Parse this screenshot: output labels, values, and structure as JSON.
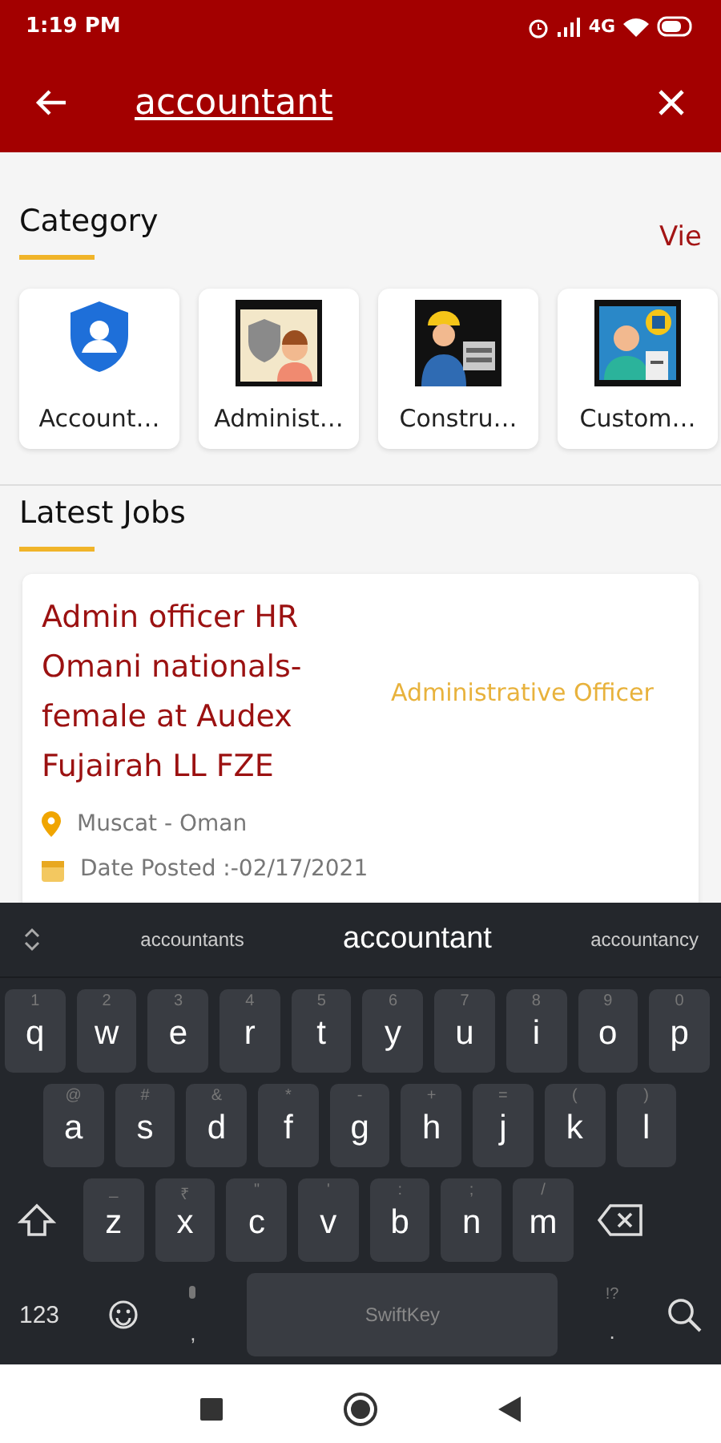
{
  "status_bar": {
    "time": "1:19 PM",
    "network": "4G"
  },
  "search": {
    "value": "accountant"
  },
  "category": {
    "title": "Category",
    "view_all": "Vie",
    "items": [
      {
        "label": "Account…",
        "kind": "shield"
      },
      {
        "label": "Administ…",
        "kind": "admin"
      },
      {
        "label": "Constru…",
        "kind": "construction"
      },
      {
        "label": "Custom…",
        "kind": "support"
      }
    ]
  },
  "latest_jobs": {
    "title": "Latest Jobs",
    "jobs": [
      {
        "title": "Admin officer HR Omani nationals-female at Audex Fujairah LL FZE",
        "category": "Administrative Officer",
        "location": "Muscat - Oman",
        "date": "Date Posted :-02/17/2021"
      }
    ]
  },
  "keyboard": {
    "suggestions": [
      {
        "text": "accountants",
        "selected": false
      },
      {
        "text": "accountant",
        "selected": true
      },
      {
        "text": "accountancy",
        "selected": false
      }
    ],
    "rows": [
      [
        {
          "key": "q",
          "hint": "1"
        },
        {
          "key": "w",
          "hint": "2"
        },
        {
          "key": "e",
          "hint": "3"
        },
        {
          "key": "r",
          "hint": "4"
        },
        {
          "key": "t",
          "hint": "5"
        },
        {
          "key": "y",
          "hint": "6"
        },
        {
          "key": "u",
          "hint": "7"
        },
        {
          "key": "i",
          "hint": "8"
        },
        {
          "key": "o",
          "hint": "9"
        },
        {
          "key": "p",
          "hint": "0"
        }
      ],
      [
        {
          "key": "a",
          "hint": "@"
        },
        {
          "key": "s",
          "hint": "#"
        },
        {
          "key": "d",
          "hint": "&"
        },
        {
          "key": "f",
          "hint": "*"
        },
        {
          "key": "g",
          "hint": "-"
        },
        {
          "key": "h",
          "hint": "+"
        },
        {
          "key": "j",
          "hint": "="
        },
        {
          "key": "k",
          "hint": "("
        },
        {
          "key": "l",
          "hint": ")"
        }
      ],
      [
        {
          "key": "z",
          "hint": "_"
        },
        {
          "key": "x",
          "hint": "₹"
        },
        {
          "key": "c",
          "hint": "\""
        },
        {
          "key": "v",
          "hint": "'"
        },
        {
          "key": "b",
          "hint": ":"
        },
        {
          "key": "n",
          "hint": ";"
        },
        {
          "key": "m",
          "hint": "/"
        }
      ]
    ],
    "numbers": "123",
    "comma": ",",
    "space": "SwiftKey",
    "period": ".",
    "period_hint": "!?"
  }
}
